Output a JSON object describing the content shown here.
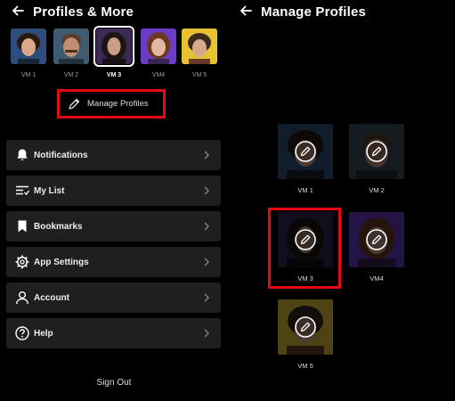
{
  "left": {
    "title": "Profiles & More",
    "profiles": [
      {
        "name": "VM 1",
        "bg": "#2d4e7a",
        "face": "#d9a98a",
        "hair": "#2b1a12"
      },
      {
        "name": "VM 2",
        "bg": "#3f5b70",
        "face": "#c38d73",
        "hair": "#5a3b28"
      },
      {
        "name": "VM 3",
        "bg": "#3a2a55",
        "face": "#caa085",
        "hair": "#1d1414"
      },
      {
        "name": "VM4",
        "bg": "#6a3cc8",
        "face": "#e2b8a0",
        "hair": "#6b3a1e"
      },
      {
        "name": "VM 5",
        "bg": "#e8c233",
        "face": "#d8a98c",
        "hair": "#3a2a1c"
      }
    ],
    "active_profile": "VM 3",
    "manage_label": "Manage Profiles",
    "menu": [
      {
        "label": "Notifications",
        "icon": "bell-icon"
      },
      {
        "label": "My List",
        "icon": "list-icon"
      },
      {
        "label": "Bookmarks",
        "icon": "bookmark-icon"
      },
      {
        "label": "App Settings",
        "icon": "gear-icon"
      },
      {
        "label": "Account",
        "icon": "person-icon"
      },
      {
        "label": "Help",
        "icon": "help-icon"
      }
    ],
    "signout_label": "Sign Out"
  },
  "right": {
    "title": "Manage Profiles",
    "profiles": [
      "VM 1",
      "VM 2",
      "VM 3",
      "VM4",
      "VM 5"
    ]
  },
  "colors": {
    "accent_red": "#e50914",
    "menu_bg": "#1f1f1f",
    "background": "#000000"
  }
}
